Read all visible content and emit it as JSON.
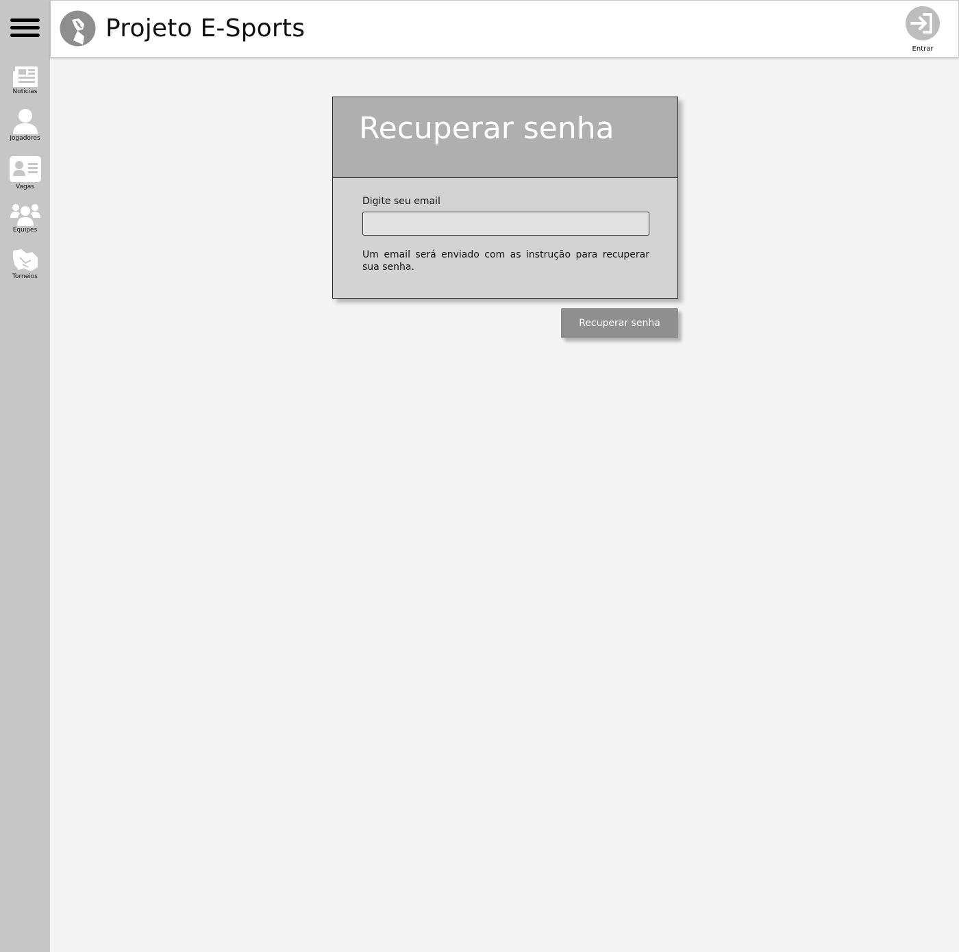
{
  "sidebar": {
    "menu_icon": "hamburger-icon",
    "items": [
      {
        "label": "Noticias",
        "icon": "newspaper-icon"
      },
      {
        "label": "Jogadores",
        "icon": "user-icon"
      },
      {
        "label": "Vagas",
        "icon": "id-card-icon"
      },
      {
        "label": "Equipes",
        "icon": "users-group-icon"
      },
      {
        "label": "Torneios",
        "icon": "handshake-icon"
      }
    ]
  },
  "header": {
    "logo_icon": "arm-wrestling-logo-icon",
    "title": "Projeto E-Sports",
    "login_label": "Entrar",
    "login_icon": "sign-in-icon"
  },
  "card": {
    "title": "Recuperar senha",
    "email_label": "Digite seu email",
    "email_value": "",
    "email_placeholder": "",
    "info_text": "Um email será enviado com as instrução para recuperar sua senha."
  },
  "actions": {
    "submit_label": "Recuperar senha"
  },
  "colors": {
    "sidebar_bg": "#c6c6c6",
    "page_bg": "#f4f4f4",
    "card_head_bg": "#afafaf",
    "card_body_bg": "#d3d3d3",
    "button_bg": "#8f8f8f"
  }
}
